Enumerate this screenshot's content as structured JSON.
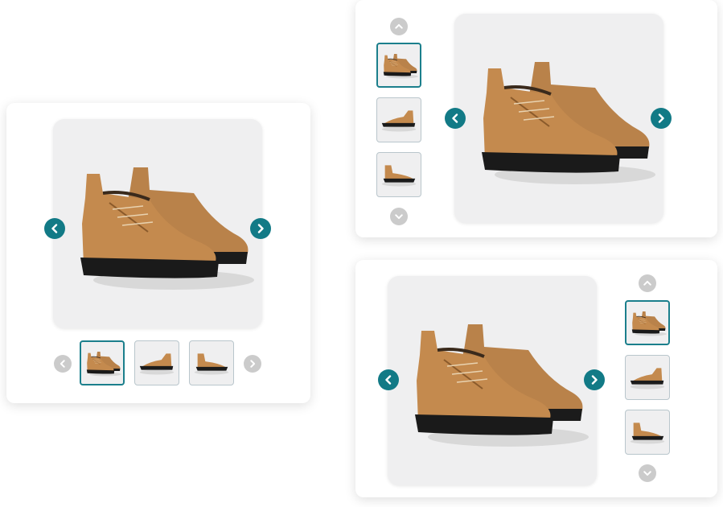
{
  "colors": {
    "accent": "#127a86",
    "thumb_active_border": "#1b7f8c",
    "muted_button": "#cbcbcb",
    "image_bg": "#efeff0",
    "boot": "#c48a4e"
  },
  "icons": {
    "prev": "chevron-left-icon",
    "next": "chevron-right-icon",
    "up": "chevron-up-icon",
    "down": "chevron-down-icon"
  },
  "galleries": [
    {
      "layout": "thumbnails-bottom",
      "active_thumbnail": 1,
      "thumbnails": [
        "boot-pair",
        "boot-side",
        "boot-side-profile"
      ]
    },
    {
      "layout": "thumbnails-left",
      "active_thumbnail": 1,
      "thumbnails": [
        "boot-pair",
        "boot-side",
        "boot-side-profile"
      ]
    },
    {
      "layout": "thumbnails-right",
      "active_thumbnail": 1,
      "thumbnails": [
        "boot-pair",
        "boot-side",
        "boot-side-profile"
      ]
    }
  ]
}
